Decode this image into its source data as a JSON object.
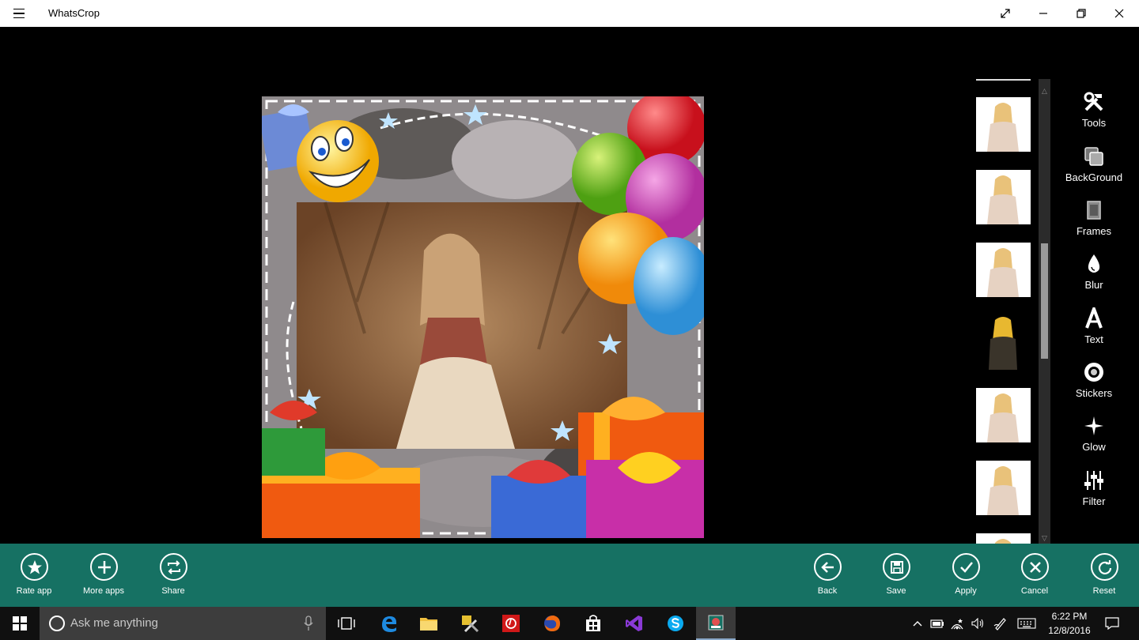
{
  "window": {
    "title": "WhatsCrop",
    "controls": [
      "fullscreen-icon",
      "minimize-icon",
      "maximize-icon",
      "close-icon"
    ]
  },
  "tools_panel": {
    "items": [
      {
        "label": "Tools",
        "icon": "hammer-wrench-icon"
      },
      {
        "label": "BackGround",
        "icon": "layers-icon"
      },
      {
        "label": "Frames",
        "icon": "frame-icon"
      },
      {
        "label": "Blur",
        "icon": "droplet-icon"
      },
      {
        "label": "Text",
        "icon": "text-a-icon"
      },
      {
        "label": "Stickers",
        "icon": "sticker-icon"
      },
      {
        "label": "Glow",
        "icon": "sparkle-icon"
      },
      {
        "label": "Filter",
        "icon": "sliders-icon"
      }
    ]
  },
  "thumbnails": {
    "count_visible": 6
  },
  "bottom_bar": {
    "left": [
      {
        "label": "Rate app",
        "icon": "star-icon"
      },
      {
        "label": "More apps",
        "icon": "plus-icon"
      },
      {
        "label": "Share",
        "icon": "share-icon"
      }
    ],
    "right": [
      {
        "label": "Back",
        "icon": "back-arrow-icon"
      },
      {
        "label": "Save",
        "icon": "save-icon"
      },
      {
        "label": "Apply",
        "icon": "check-icon"
      },
      {
        "label": "Cancel",
        "icon": "x-icon"
      },
      {
        "label": "Reset",
        "icon": "refresh-icon"
      }
    ]
  },
  "taskbar": {
    "search_placeholder": "Ask me anything",
    "apps": [
      "task-view-icon",
      "edge-icon",
      "file-explorer-icon",
      "tools-app-icon",
      "red-app-icon",
      "firefox-icon",
      "store-icon",
      "visual-studio-icon",
      "skype-icon",
      "whatscrop-icon"
    ],
    "time": "6:22 PM",
    "date": "12/8/2016"
  },
  "colors": {
    "appbar": "#167163",
    "titlebar": "#ffffff",
    "canvas": "#000000",
    "taskbar": "#101010"
  }
}
